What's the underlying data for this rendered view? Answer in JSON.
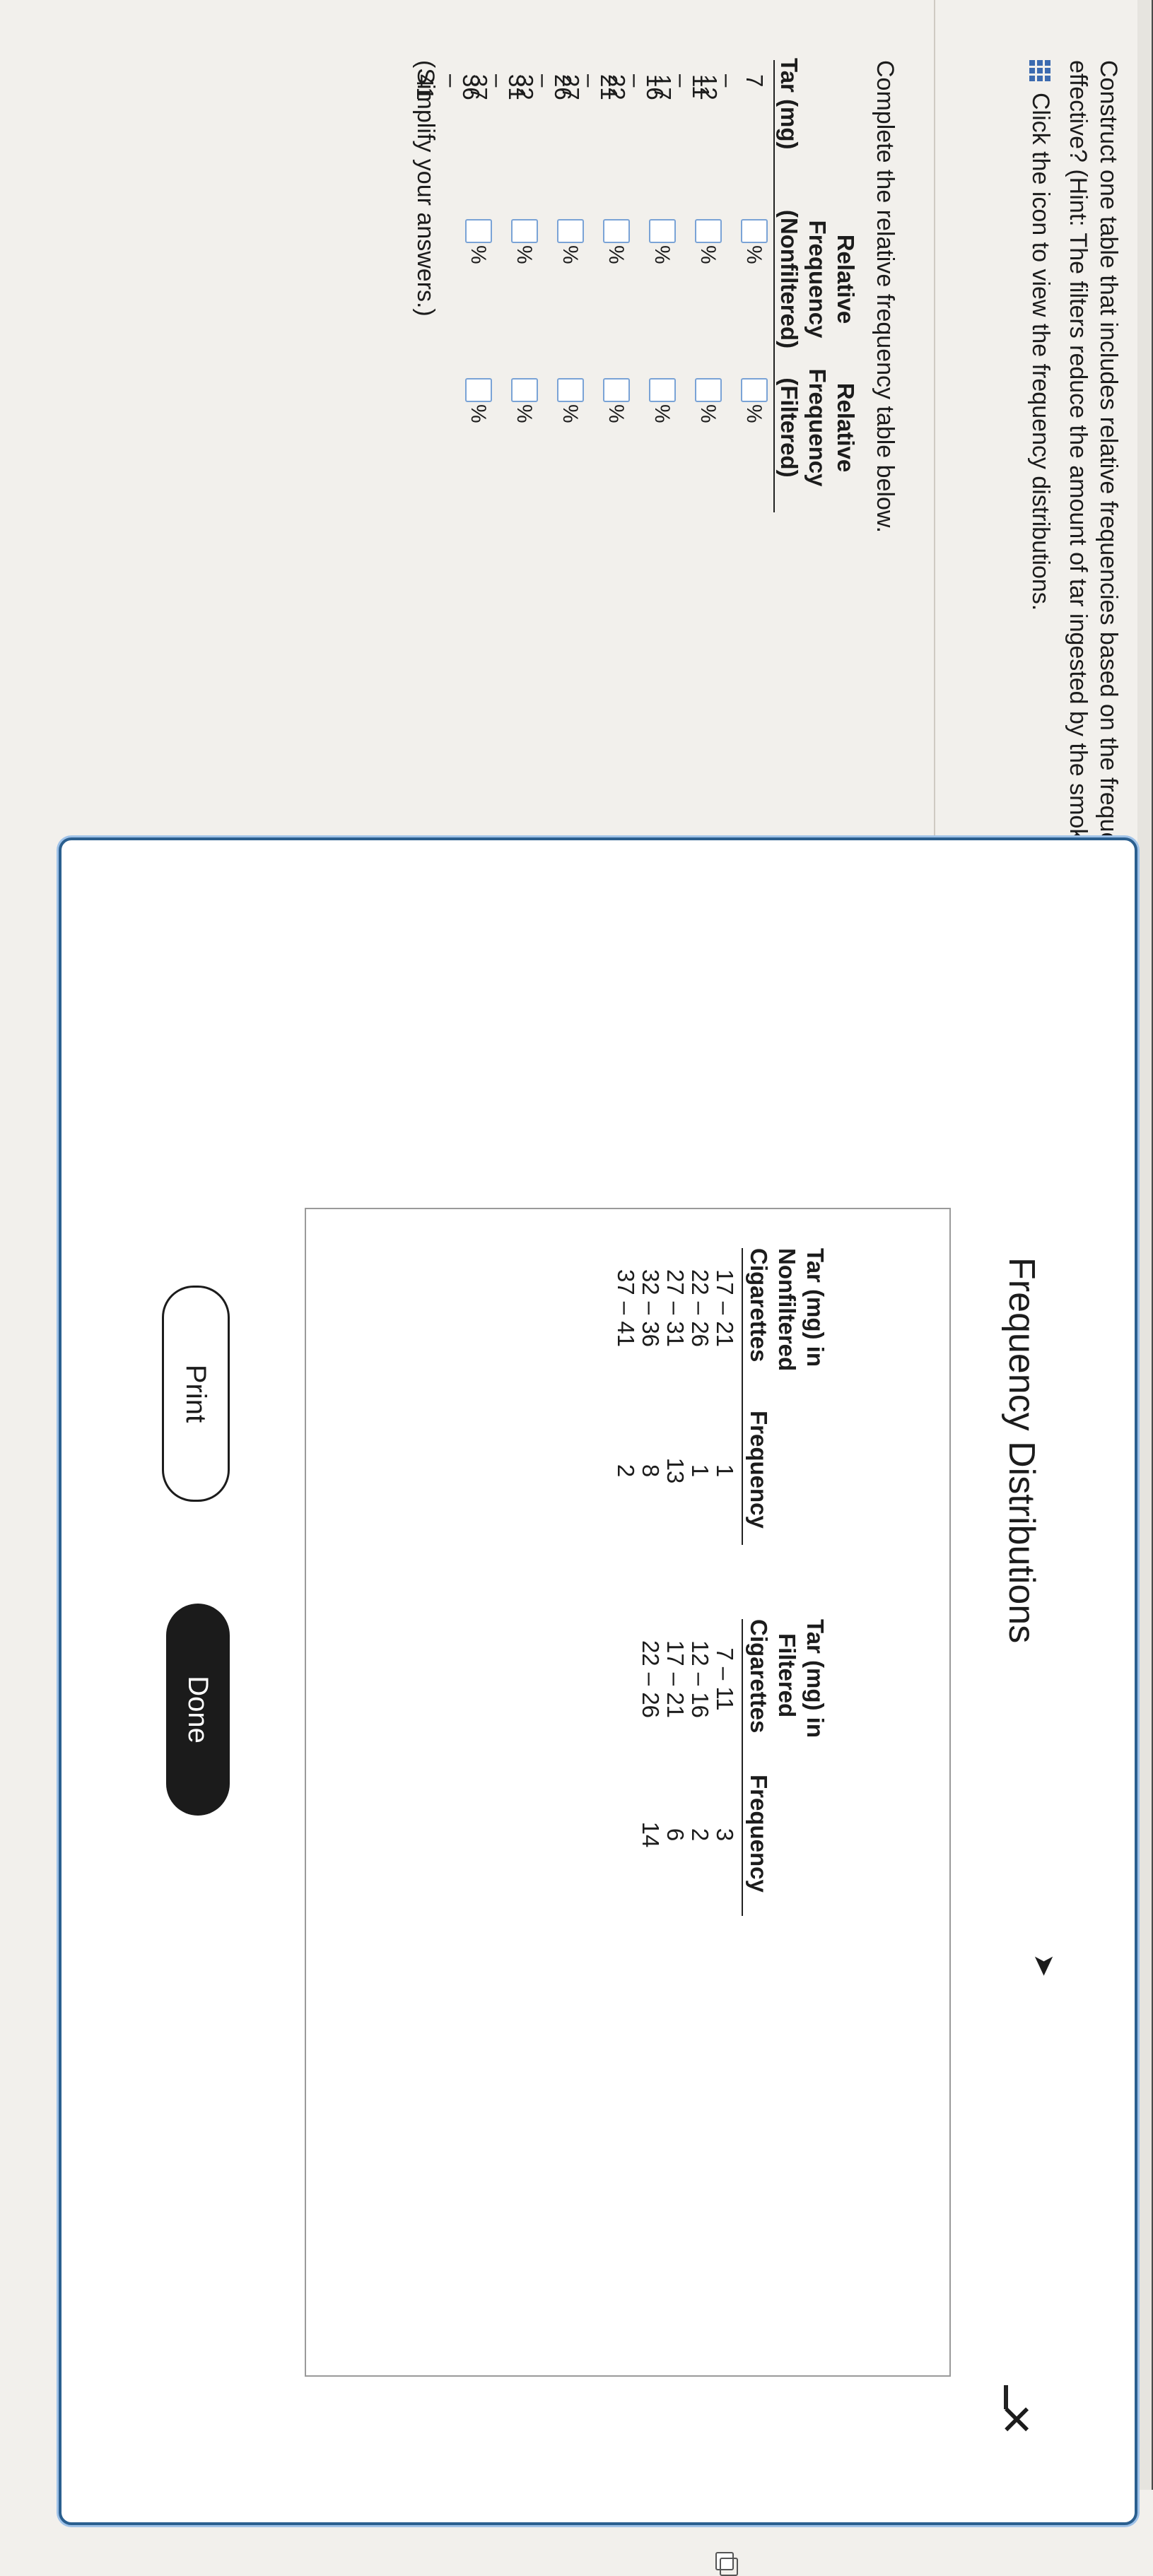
{
  "problem": {
    "text": "Construct one table that includes relative frequencies based on the frequency distributions shown below, then compare the amounts of tar in nonfiltered and filtered cigarettes. Do the cigarette filters appear to be effective? (Hint: The filters reduce the amount of tar ingested by the smoker.)",
    "icon_label": "Click the icon to view the frequency distributions."
  },
  "more_label": "•••••",
  "answer": {
    "instruction": "Complete the relative frequency table below.",
    "headers": {
      "col1": "Tar (mg)",
      "col2_line1": "Relative",
      "col2_line2": "Frequency",
      "col2_line3": "(Nonfiltered)",
      "col3_line1": "Relative",
      "col3_line2": "Frequency",
      "col3_line3": "(Filtered)"
    },
    "pct": "%",
    "rows": [
      {
        "range": "7 – 11",
        "nonfiltered": "",
        "filtered": ""
      },
      {
        "range": "12 – 16",
        "nonfiltered": "",
        "filtered": ""
      },
      {
        "range": "17 – 21",
        "nonfiltered": "",
        "filtered": ""
      },
      {
        "range": "22 – 26",
        "nonfiltered": "",
        "filtered": ""
      },
      {
        "range": "27 – 31",
        "nonfiltered": "",
        "filtered": ""
      },
      {
        "range": "32 – 36",
        "nonfiltered": "",
        "filtered": ""
      },
      {
        "range": "37 – 41",
        "nonfiltered": "",
        "filtered": ""
      }
    ],
    "simplify": "(Simplify your answers.)"
  },
  "dialog": {
    "title": "Frequency Distributions",
    "close": "✕",
    "nonfiltered": {
      "h1": "Tar (mg) in",
      "h2": "Nonfiltered",
      "h3": "Cigarettes",
      "freq_label": "Frequency",
      "rows": [
        {
          "range": "17 – 21",
          "freq": "1"
        },
        {
          "range": "22 – 26",
          "freq": "1"
        },
        {
          "range": "27 – 31",
          "freq": "13"
        },
        {
          "range": "32 – 36",
          "freq": "8"
        },
        {
          "range": "37 – 41",
          "freq": "2"
        }
      ]
    },
    "filtered": {
      "h1": "Tar (mg) in",
      "h2": "Filtered",
      "h3": "Cigarettes",
      "freq_label": "Frequency",
      "rows": [
        {
          "range": "7 – 11",
          "freq": "3"
        },
        {
          "range": "12 – 16",
          "freq": "2"
        },
        {
          "range": "17 – 21",
          "freq": "6"
        },
        {
          "range": "22 – 26",
          "freq": "14"
        }
      ]
    },
    "print_label": "Print",
    "done_label": "Done"
  },
  "colors": {
    "accent": "#2b5f8f",
    "input_border": "#7aa3d6",
    "done_bg": "#1b1b1b"
  }
}
